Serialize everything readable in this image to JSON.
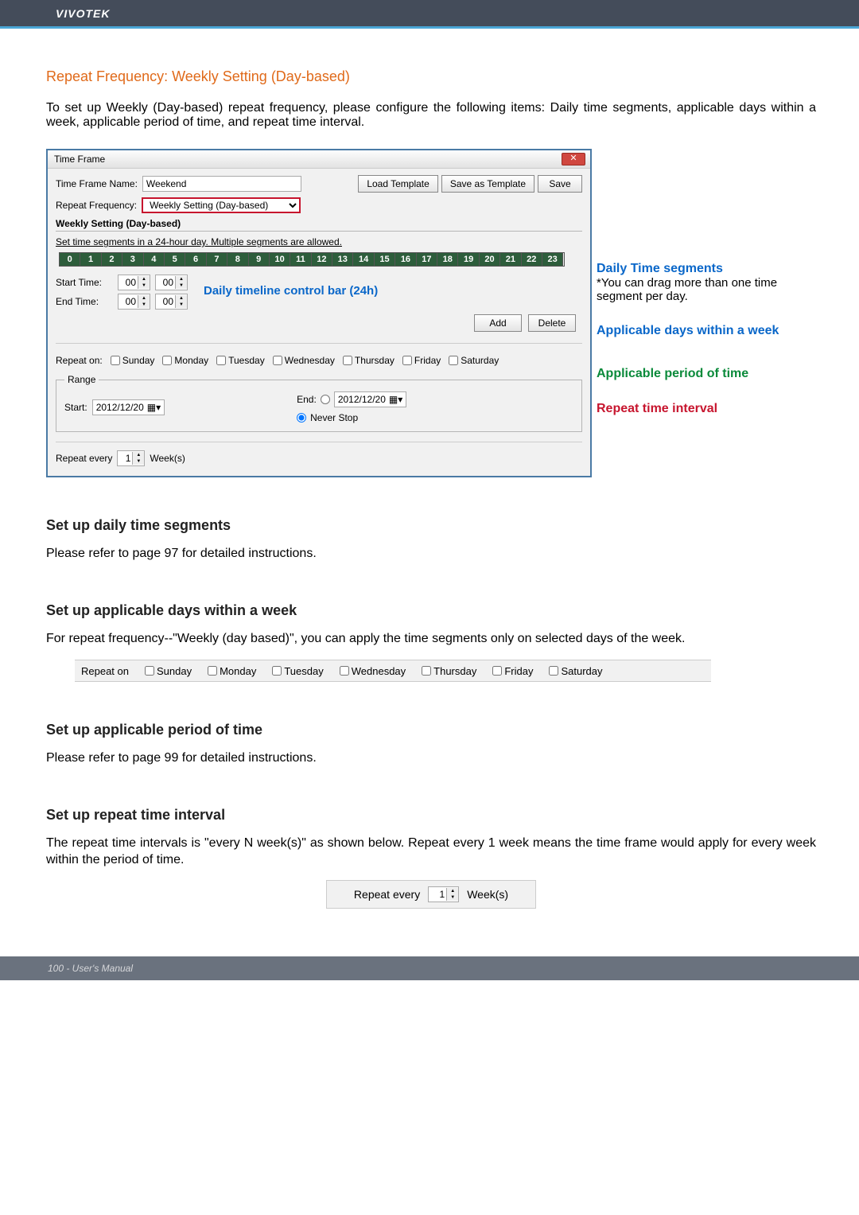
{
  "header": {
    "brand": "VIVOTEK"
  },
  "section_title": "Repeat Frequency: Weekly Setting (Day-based)",
  "intro": "To set up Weekly (Day-based) repeat frequency, please configure the following items: Daily time segments, applicable days within a week, applicable period of time, and repeat time interval.",
  "dialog": {
    "title": "Time Frame",
    "close": "✕",
    "frame_name_label": "Time Frame Name:",
    "frame_name_value": "Weekend",
    "load_template": "Load Template",
    "save_as_template": "Save as Template",
    "save": "Save",
    "repeat_freq_label": "Repeat Frequency:",
    "repeat_freq_value": "Weekly Setting (Day-based)",
    "group_title": "Weekly Setting (Day-based)",
    "group_sub": "Set time segments in a 24-hour day. Multiple segments are allowed.",
    "hours": [
      "0",
      "1",
      "2",
      "3",
      "4",
      "5",
      "6",
      "7",
      "8",
      "9",
      "10",
      "11",
      "12",
      "13",
      "14",
      "15",
      "16",
      "17",
      "18",
      "19",
      "20",
      "21",
      "22",
      "23"
    ],
    "timeline_label": "Daily timeline control bar (24h)",
    "start_time_label": "Start Time:",
    "end_time_label": "End Time:",
    "start_hh": "00",
    "start_mm": "00",
    "end_hh": "00",
    "end_mm": "00",
    "add": "Add",
    "delete": "Delete",
    "repeat_on_label": "Repeat on:",
    "days": [
      "Sunday",
      "Monday",
      "Tuesday",
      "Wednesday",
      "Thursday",
      "Friday",
      "Saturday"
    ],
    "range_legend": "Range",
    "range_start_label": "Start:",
    "range_start_value": "2012/12/20",
    "range_end_label": "End:",
    "range_end_value": "2012/12/20",
    "never_stop": "Never Stop",
    "repeat_every_label": "Repeat every",
    "repeat_every_value": "1",
    "repeat_every_unit": "Week(s)"
  },
  "annotations": {
    "daily_title": "Daily Time segments",
    "daily_note": "*You can drag more than one time segment per day.",
    "applicable_days": "Applicable days within a week",
    "applicable_period": "Applicable period of time",
    "repeat_interval": "Repeat time interval"
  },
  "sec1_title": "Set up daily time segments",
  "sec1_body": "Please refer to page 97 for detailed instructions.",
  "sec2_title": "Set up applicable days within a week",
  "sec2_body": "For repeat frequency--\"Weekly (day based)\", you can apply the time segments only on selected days of the week.",
  "repeat_on_strip": {
    "label": "Repeat on",
    "days": [
      "Sunday",
      "Monday",
      "Tuesday",
      "Wednesday",
      "Thursday",
      "Friday",
      "Saturday"
    ]
  },
  "sec3_title": "Set up applicable period of time",
  "sec3_body": "Please refer to page 99 for detailed instructions.",
  "sec4_title": "Set up repeat time interval",
  "sec4_body": "The repeat time intervals is \"every N week(s)\" as shown below. Repeat every 1 week means the time frame would apply for every week within the period of time.",
  "repeat_every_strip": {
    "label": "Repeat every",
    "value": "1",
    "unit": "Week(s)"
  },
  "footer": "100 - User's Manual"
}
